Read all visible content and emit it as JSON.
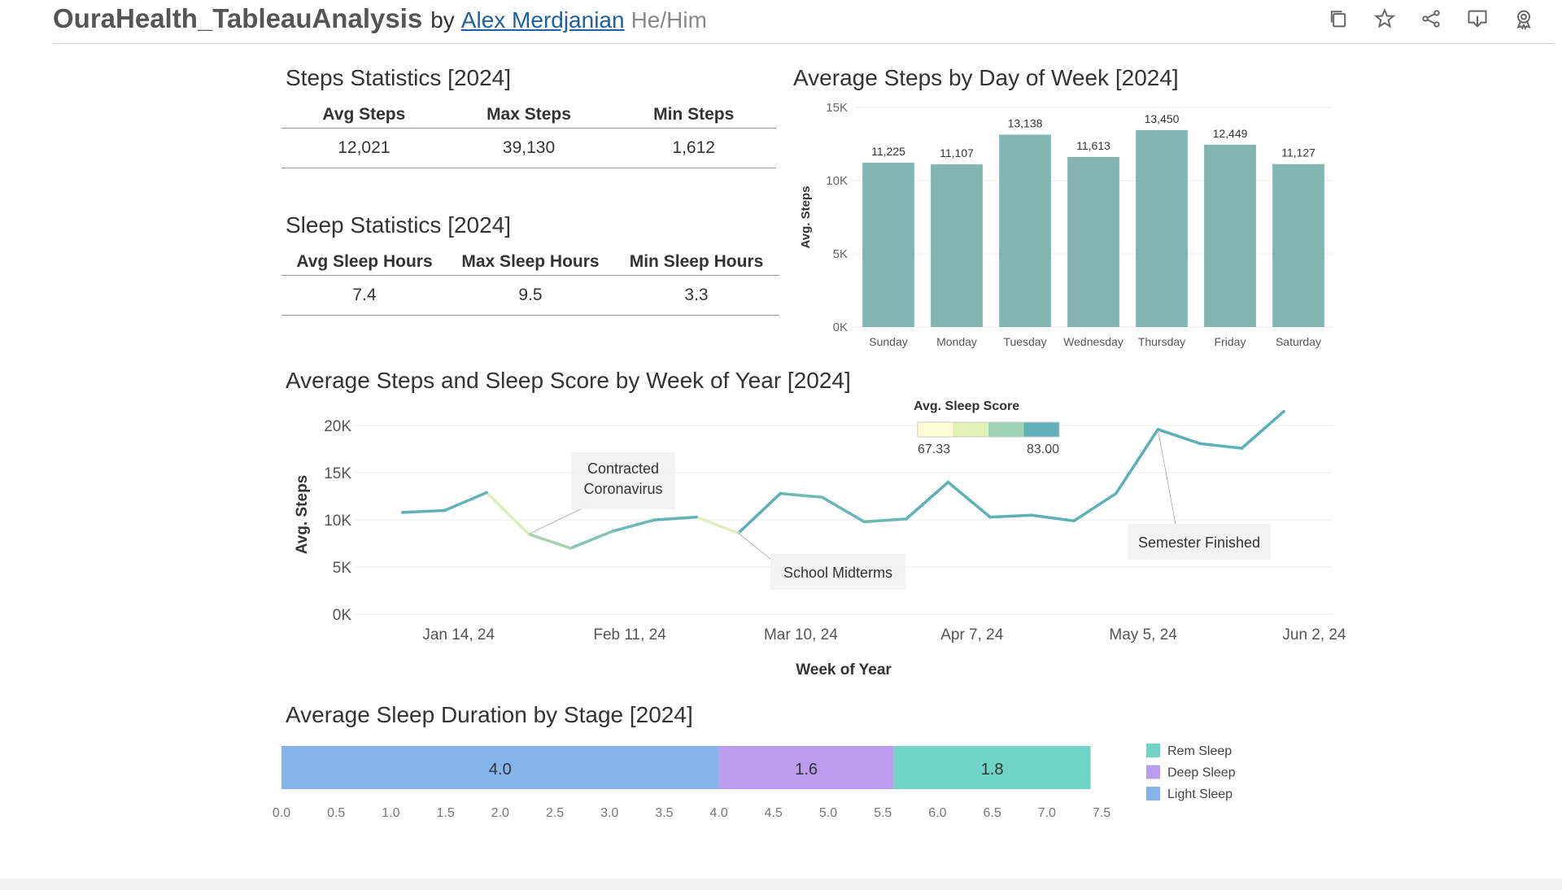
{
  "header": {
    "title": "OuraHealth_TableauAnalysis",
    "by": "by",
    "author": "Alex Merdjanian",
    "pronouns": "He/Him",
    "icons": [
      "copy-icon",
      "star-icon",
      "share-icon",
      "download-icon",
      "badge-icon"
    ]
  },
  "steps_stats": {
    "title": "Steps Statistics [2024]",
    "headers": [
      "Avg Steps",
      "Max Steps",
      "Min Steps"
    ],
    "values": [
      "12,021",
      "39,130",
      "1,612"
    ]
  },
  "sleep_stats": {
    "title": "Sleep Statistics [2024]",
    "headers": [
      "Avg Sleep Hours",
      "Max Sleep Hours",
      "Min Sleep Hours"
    ],
    "values": [
      "7.4",
      "9.5",
      "3.3"
    ]
  },
  "chart_data": [
    {
      "type": "bar",
      "title": "Average Steps by Day of Week [2024]",
      "ylabel": "Avg. Steps",
      "categories": [
        "Sunday",
        "Monday",
        "Tuesday",
        "Wednesday",
        "Thursday",
        "Friday",
        "Saturday"
      ],
      "values": [
        11225,
        11107,
        13138,
        11613,
        13450,
        12449,
        11127
      ],
      "value_labels": [
        "11,225",
        "11,107",
        "13,138",
        "11,613",
        "13,450",
        "12,449",
        "11,127"
      ],
      "ylim": [
        0,
        15000
      ],
      "yticks": [
        0,
        5000,
        10000,
        15000
      ],
      "ytick_labels": [
        "0K",
        "5K",
        "10K",
        "15K"
      ],
      "color": "#84b6b1",
      "grid": true
    },
    {
      "type": "line",
      "title": "Average Steps and Sleep Score by Week of Year [2024]",
      "xlabel": "Week of Year",
      "ylabel": "Avg. Steps",
      "x": [
        "2024-01-07",
        "2024-01-07",
        "2024-01-14",
        "2024-01-21",
        "2024-01-28",
        "2024-02-04",
        "2024-02-11",
        "2024-02-18",
        "2024-02-25",
        "2024-03-03",
        "2024-03-10",
        "2024-03-17",
        "2024-03-24",
        "2024-03-31",
        "2024-04-07",
        "2024-04-14",
        "2024-04-21",
        "2024-04-28",
        "2024-05-05",
        "2024-05-12",
        "2024-05-19",
        "2024-05-26"
      ],
      "series": [
        {
          "values": [
            10800,
            11000,
            12900,
            8500,
            7000,
            8800,
            10000,
            10300,
            8600,
            12800,
            12400,
            9800,
            10100,
            14000,
            10300,
            10500,
            9900,
            12800,
            19600,
            18100,
            17600,
            21500
          ]
        }
      ],
      "sleep_score_colors": [
        "#5fb0b8",
        "#5fb0b8",
        "#62b2b6",
        "#ddeebc",
        "#a3d3b2",
        "#84c4b4",
        "#6cb8b6",
        "#63b3b6",
        "#e0eebb",
        "#5cb0b8",
        "#6fb8b5",
        "#67b5b6",
        "#6ab7b6",
        "#5cb0b8",
        "#5fb1b8",
        "#5fb1b8",
        "#5fb1b8",
        "#5fb1b8",
        "#5cb0b8",
        "#5cb0b8",
        "#5cb0b8",
        "#5cb0b8"
      ],
      "xticks": [
        "2024-01-14",
        "2024-02-11",
        "2024-03-10",
        "2024-04-07",
        "2024-05-05",
        "2024-06-02"
      ],
      "xtick_labels": [
        "Jan 14, 24",
        "Feb 11, 24",
        "Mar 10, 24",
        "Apr 7, 24",
        "May 5, 24",
        "Jun 2, 24"
      ],
      "xlim": [
        "2023-12-28",
        "2024-06-05"
      ],
      "ylim": [
        0,
        22000
      ],
      "yticks": [
        0,
        5000,
        10000,
        15000,
        20000
      ],
      "ytick_labels": [
        "0K",
        "5K",
        "10K",
        "15K",
        "20K"
      ],
      "legend": {
        "title": "Avg. Sleep Score",
        "min_label": "67.33",
        "max_label": "83.00",
        "colors": [
          "#fcfcd6",
          "#e0efb8",
          "#9ed4b6",
          "#5fb0b8"
        ]
      },
      "annotations": [
        {
          "label": "Contracted\nCoronavirus",
          "point": 3
        },
        {
          "label": "School Midterms",
          "point": 8
        },
        {
          "label": "Semester Finished",
          "point": 18
        }
      ],
      "grid": true
    },
    {
      "type": "bar",
      "orientation": "horizontal-stacked",
      "title": "Average Sleep Duration by Stage [2024]",
      "series": [
        {
          "name": "Light Sleep",
          "values": [
            4.0
          ],
          "value_label": "4.0",
          "color": "#85b4ea"
        },
        {
          "name": "Deep Sleep",
          "values": [
            1.6
          ],
          "value_label": "1.6",
          "color": "#bb9bed"
        },
        {
          "name": "Rem Sleep",
          "values": [
            1.8
          ],
          "value_label": "1.8",
          "color": "#71d2c8"
        }
      ],
      "xlim": [
        0,
        7.5
      ],
      "xticks": [
        0,
        0.5,
        1,
        1.5,
        2,
        2.5,
        3,
        3.5,
        4,
        4.5,
        5,
        5.5,
        6,
        6.5,
        7,
        7.5
      ],
      "xtick_labels": [
        "0.0",
        "0.5",
        "1.0",
        "1.5",
        "2.0",
        "2.5",
        "3.0",
        "3.5",
        "4.0",
        "4.5",
        "5.0",
        "5.5",
        "6.0",
        "6.5",
        "7.0",
        "7.5"
      ],
      "legend_order": [
        "Rem Sleep",
        "Deep Sleep",
        "Light Sleep"
      ],
      "legend_position": "right"
    }
  ]
}
